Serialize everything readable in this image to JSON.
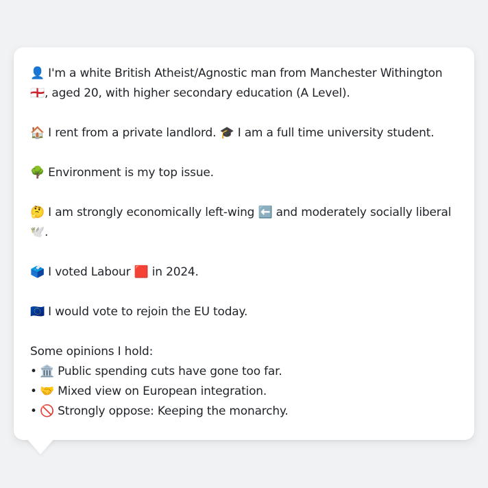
{
  "message": {
    "identity_line": "👤 I'm a white British Atheist/Agnostic man from Manchester Withington 🏴󠁧󠁢󠁥󠁮󠁧󠁿, aged 20, with higher secondary education (A Level).",
    "housing_line": "🏠 I rent from a private landlord. 🎓 I am a full time university student.",
    "issue_line": "🌳 Environment is my top issue.",
    "ideology_line": "🤔 I am strongly economically left-wing ⬅️ and moderately socially liberal 🕊️.",
    "vote_line": "🗳️ I voted Labour 🟥 in 2024.",
    "eu_line": "🇪🇺 I would vote to rejoin the EU today.",
    "opinions_heading": "Some opinions I hold:",
    "bullet_char": "•",
    "opinions": [
      "🏛️ Public spending cuts have gone too far.",
      "🤝 Mixed view on European integration.",
      "🚫 Strongly oppose: Keeping the monarchy."
    ]
  }
}
